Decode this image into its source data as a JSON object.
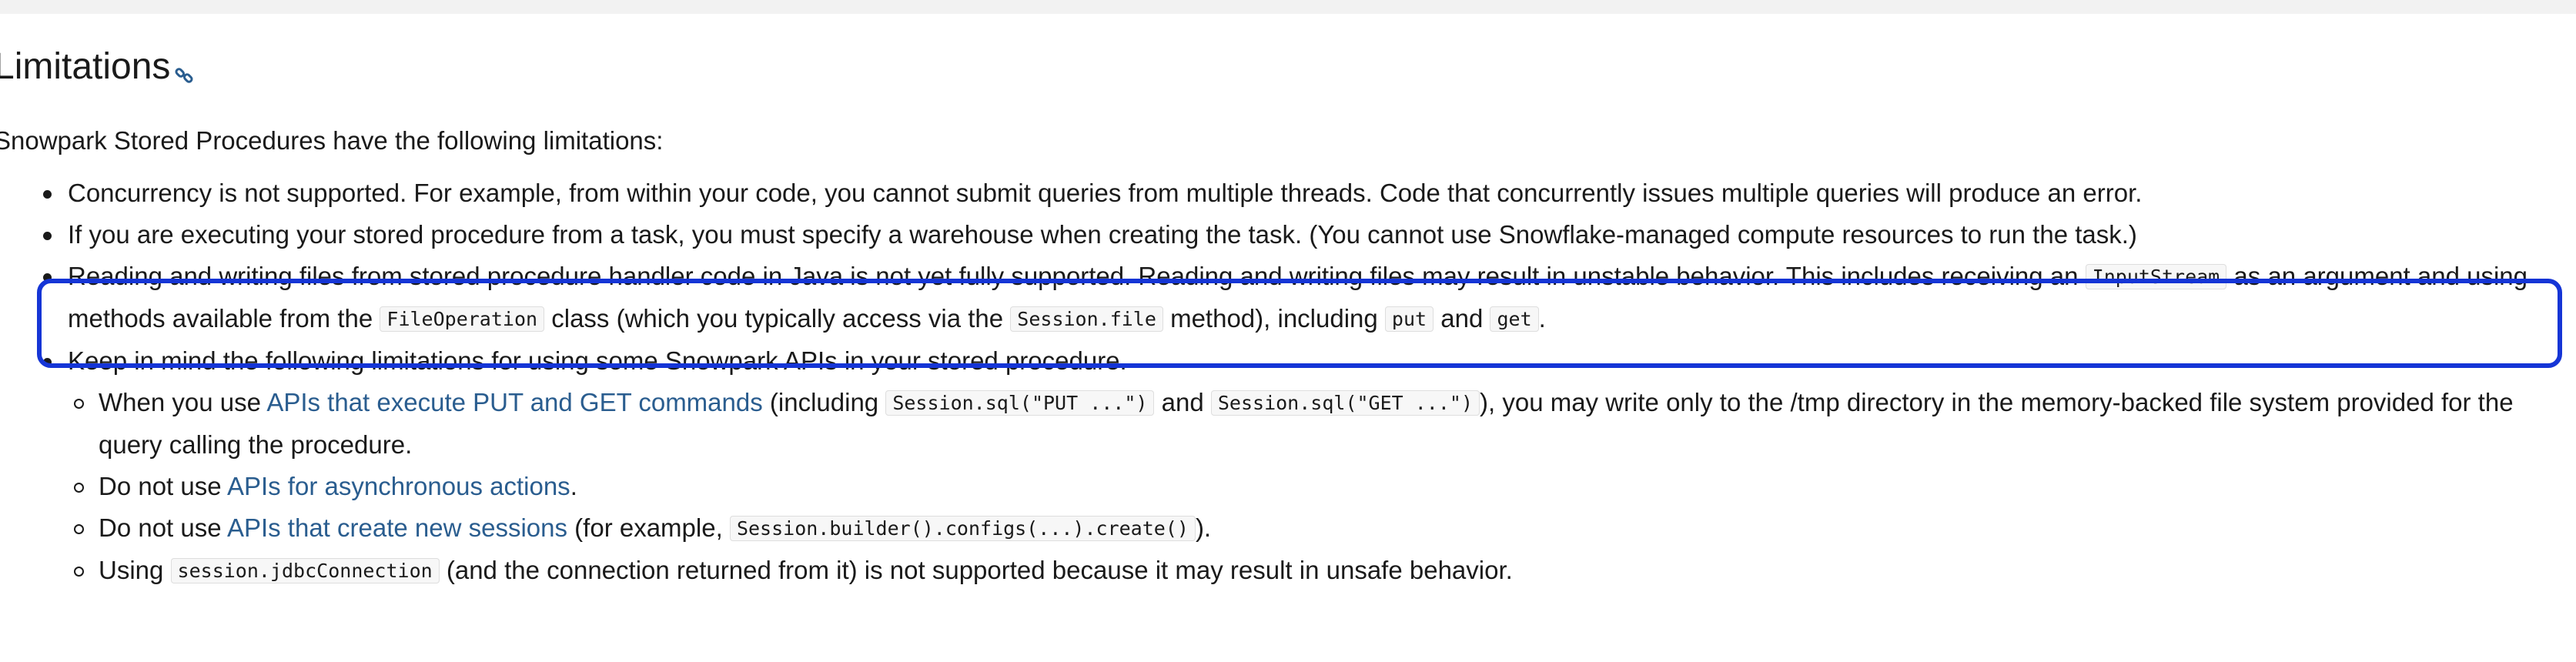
{
  "page": {
    "heading": "Limitations",
    "anchor_icon": "link-icon",
    "intro": "Snowpark Stored Procedures have the following limitations:"
  },
  "limitations": {
    "item1": "Concurrency is not supported. For example, from within your code, you cannot submit queries from multiple threads. Code that concurrently issues multiple queries will produce an error.",
    "item2": "If you are executing your stored procedure from a task, you must specify a warehouse when creating the task. (You cannot use Snowflake-managed compute resources to run the task.)",
    "item3": {
      "t1": "Reading and writing files from stored procedure handler code in Java is not yet fully supported. Reading and writing files may result in unstable behavior. This includes receiving an ",
      "c1": "InputStream",
      "t2": " as an argument and using methods available from the ",
      "c2": "FileOperation",
      "t3": " class (which you typically access via the ",
      "c3": "Session.file",
      "t4": " method), including ",
      "c4": "put",
      "t5": " and ",
      "c5": "get",
      "t6": "."
    },
    "item4": {
      "text": "Keep in mind the following limitations for using some Snowpark APIs in your stored procedure.",
      "sub1": {
        "t1": "When you use ",
        "link": "APIs that execute PUT and GET commands",
        "t2": " (including ",
        "c1": "Session.sql(\"PUT ...\")",
        "t3": " and ",
        "c2": "Session.sql(\"GET ...\")",
        "t4": "), you may write only to the /tmp directory in the memory-backed file system provided for the query calling the procedure."
      },
      "sub2": {
        "t1": "Do not use ",
        "link": "APIs for asynchronous actions",
        "t2": "."
      },
      "sub3": {
        "t1": "Do not use ",
        "link": "APIs that create new sessions",
        "t2": " (for example, ",
        "c1": "Session.builder().configs(...).create()",
        "t3": ")."
      },
      "sub4": {
        "t1": "Using ",
        "c1": "session.jdbcConnection",
        "t2": " (and the connection returned from it) is not supported because it may result in unsafe behavior."
      }
    }
  },
  "colors": {
    "link": "#2a5d8f",
    "highlight_border": "#1535d6",
    "text": "#1a1a1a"
  }
}
